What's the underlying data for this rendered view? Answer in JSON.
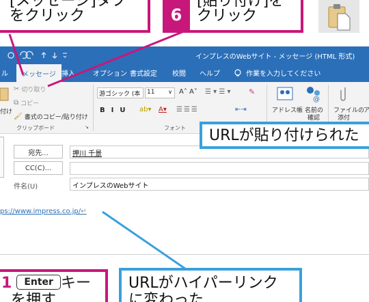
{
  "top": {
    "step5_text_1": "[メッセージ]タブ",
    "step5_text_2": "をクリック",
    "step6_number": "6",
    "step6_text_1": "[貼り付け]を",
    "step6_text_2": "クリック"
  },
  "window": {
    "title": "インプレスのWebサイト - メッセージ (HTML 形式)"
  },
  "tabs": [
    "ル",
    "メッセージ",
    "挿入",
    "オプション",
    "書式設定",
    "校閲",
    "ヘルプ",
    "作業を入力してください"
  ],
  "ribbon": {
    "cut": "切り取り",
    "copy": "コピー",
    "format_painter": "書式のコピー/貼り付け",
    "paste": "付け",
    "clipboard_group": "クリップボード",
    "font_name": "游ゴシック (本",
    "font_size": "11",
    "font_group": "フォント",
    "address_book": "アドレス帳",
    "check_names_1": "名前の",
    "check_names_2": "確認",
    "attach_file_1": "ファイルの",
    "attach_file_2": "添付",
    "more": "ア"
  },
  "fields": {
    "to_button": "宛先...",
    "to_value": "押川 千景",
    "cc_button": "CC(C)...",
    "subject_label": "件名(U)",
    "subject_value": "インプレスのWebサイト"
  },
  "body": {
    "url": "ps://www.impress.co.jp/"
  },
  "callouts": {
    "pasted": "URLが貼り付けられた",
    "enter_prefix": "1",
    "enter_key": "Enter",
    "enter_suffix": "キー",
    "enter_line2": "を押す",
    "hyperlink_1": "URLがハイパーリンク",
    "hyperlink_2": "に変わった"
  }
}
